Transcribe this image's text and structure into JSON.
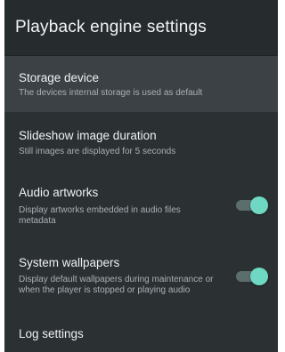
{
  "header": {
    "title": "Playback engine settings"
  },
  "items": [
    {
      "title": "Storage device",
      "subtitle": "The devices internal storage is used as default",
      "selected": true
    },
    {
      "title": "Slideshow image duration",
      "subtitle": "Still images are displayed for 5 seconds",
      "selected": false
    },
    {
      "title": "Audio artworks",
      "subtitle": "Display artworks embedded in audio files metadata",
      "toggle_on": true
    },
    {
      "title": "System wallpapers",
      "subtitle": "Display default wallpapers during maintenance or when the player is stopped or playing audio",
      "toggle_on": true
    },
    {
      "title": "Log settings"
    }
  ],
  "colors": {
    "background": "#2b3033",
    "header": "#262b2e",
    "selected_row": "#3b4145",
    "toggle_accent": "#6fd8c2"
  }
}
